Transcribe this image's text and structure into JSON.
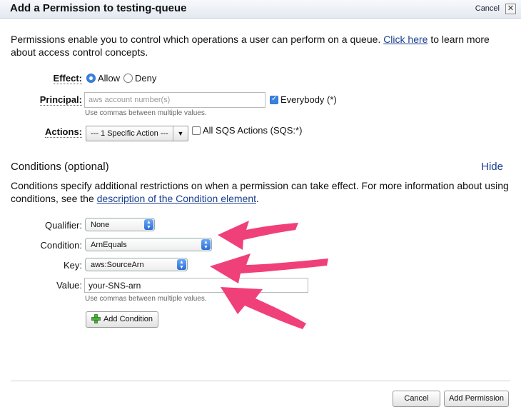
{
  "dialog": {
    "title": "Add a Permission to testing-queue",
    "cancel_link": "Cancel",
    "close_glyph": "✕"
  },
  "intro": {
    "before_link": "Permissions enable you to control which operations a user can perform on a queue. ",
    "link": "Click here",
    "after_link": " to learn more about access control concepts."
  },
  "effect": {
    "label": "Effect:",
    "options": [
      "Allow",
      "Deny"
    ],
    "selected": "Allow"
  },
  "principal": {
    "label": "Principal:",
    "placeholder": "aws account number(s)",
    "value": "",
    "hint": "Use commas between multiple values.",
    "everybody_label": "Everybody (*)",
    "everybody_checked": true
  },
  "actions": {
    "label": "Actions:",
    "selected": "--- 1 Specific Action ---",
    "all_label": "All SQS Actions (SQS:*)",
    "all_checked": false
  },
  "conditions": {
    "title": "Conditions (optional)",
    "hide_link": "Hide",
    "desc_before": "Conditions specify additional restrictions on when a permission can take effect. For more information about using conditions, see the ",
    "desc_link": "description of the Condition element",
    "desc_after": ".",
    "qualifier_label": "Qualifier:",
    "qualifier_value": "None",
    "condition_label": "Condition:",
    "condition_value": "ArnEquals",
    "key_label": "Key:",
    "key_value": "aws:SourceArn",
    "value_label": "Value:",
    "value_value": "your-SNS-arn",
    "value_hint": "Use commas between multiple values.",
    "add_button": "Add Condition"
  },
  "footer": {
    "cancel_button": "Cancel",
    "add_button": "Add Permission"
  },
  "colors": {
    "annotation_arrow": "#f0407a",
    "link": "#1a3f8f",
    "accent": "#3b82e0"
  }
}
